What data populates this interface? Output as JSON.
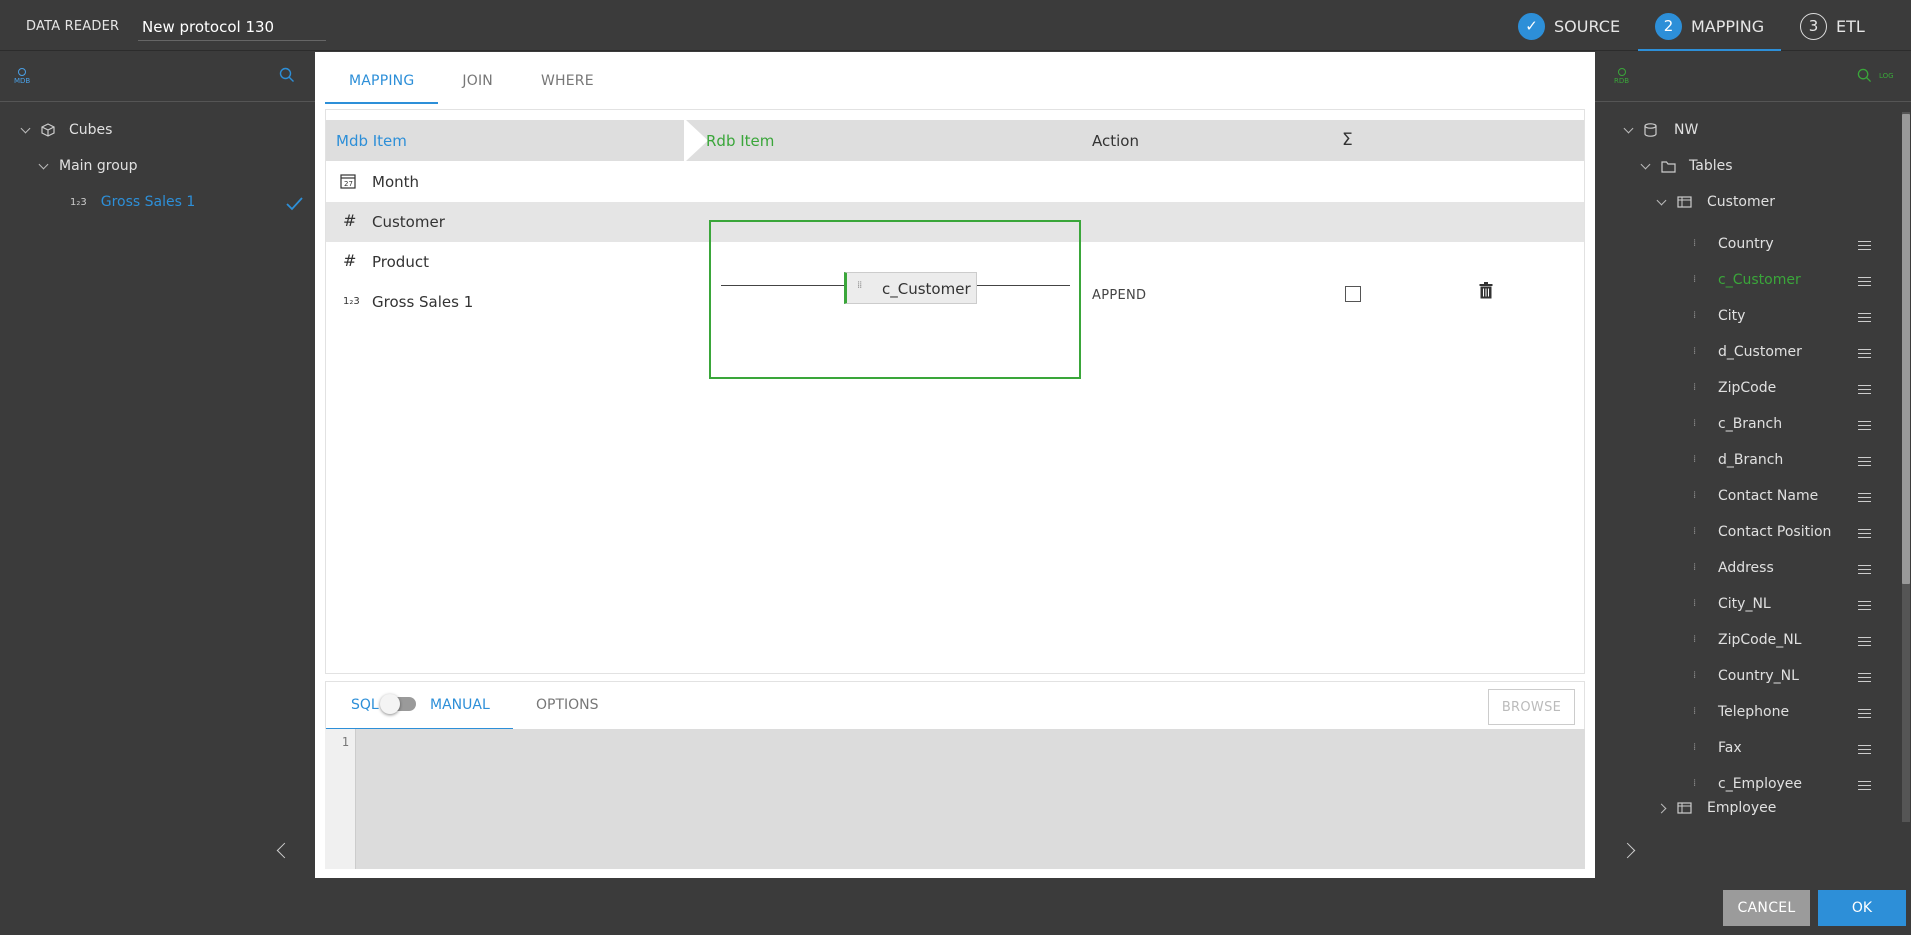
{
  "header": {
    "app_name": "DATA READER",
    "protocol_name": "New protocol 130",
    "steps": [
      {
        "number": "✓",
        "label": "SOURCE",
        "state": "done"
      },
      {
        "number": "2",
        "label": "MAPPING",
        "state": "active"
      },
      {
        "number": "3",
        "label": "ETL",
        "state": "pending"
      }
    ]
  },
  "left_panel": {
    "toolbar_icon": "MDB",
    "tree": {
      "root": "Cubes",
      "group": "Main group",
      "item": "Gross Sales 1",
      "item_icon": "1₂3"
    }
  },
  "center": {
    "tabs": [
      "MAPPING",
      "JOIN",
      "WHERE"
    ],
    "grid": {
      "headers": {
        "mdb": "Mdb Item",
        "rdb": "Rdb Item",
        "action": "Action",
        "sum": "Σ"
      },
      "rows": [
        {
          "icon": "📅",
          "label": "Month"
        },
        {
          "icon": "#",
          "label": "Customer"
        },
        {
          "icon": "#",
          "label": "Product"
        },
        {
          "icon": "1₂3",
          "label": "Gross Sales 1"
        }
      ],
      "mapped_rdb_item": "c_Customer",
      "action_value": "APPEND"
    },
    "sql": {
      "tab_sql": "SQL",
      "tab_manual": "MANUAL",
      "tab_options": "OPTIONS",
      "browse": "BROWSE",
      "line_numbers": "1"
    }
  },
  "right_panel": {
    "toolbar_icon": "RDB",
    "log_label": "LOG",
    "tree_root": "NW",
    "tables_label": "Tables",
    "table_customer": "Customer",
    "columns": [
      "Country",
      "c_Customer",
      "City",
      "d_Customer",
      "ZipCode",
      "c_Branch",
      "d_Branch",
      "Contact Name",
      "Contact Position",
      "Address",
      "City_NL",
      "ZipCode_NL",
      "Country_NL",
      "Telephone",
      "Fax",
      "c_Employee"
    ],
    "table_employee": "Employee",
    "highlight_color": "#3aa63a"
  },
  "footer": {
    "cancel": "CANCEL",
    "ok": "OK"
  },
  "colors": {
    "accent": "#2d8fd8",
    "mapped": "#3aa63a",
    "panel_bg": "#3b3b3b"
  }
}
